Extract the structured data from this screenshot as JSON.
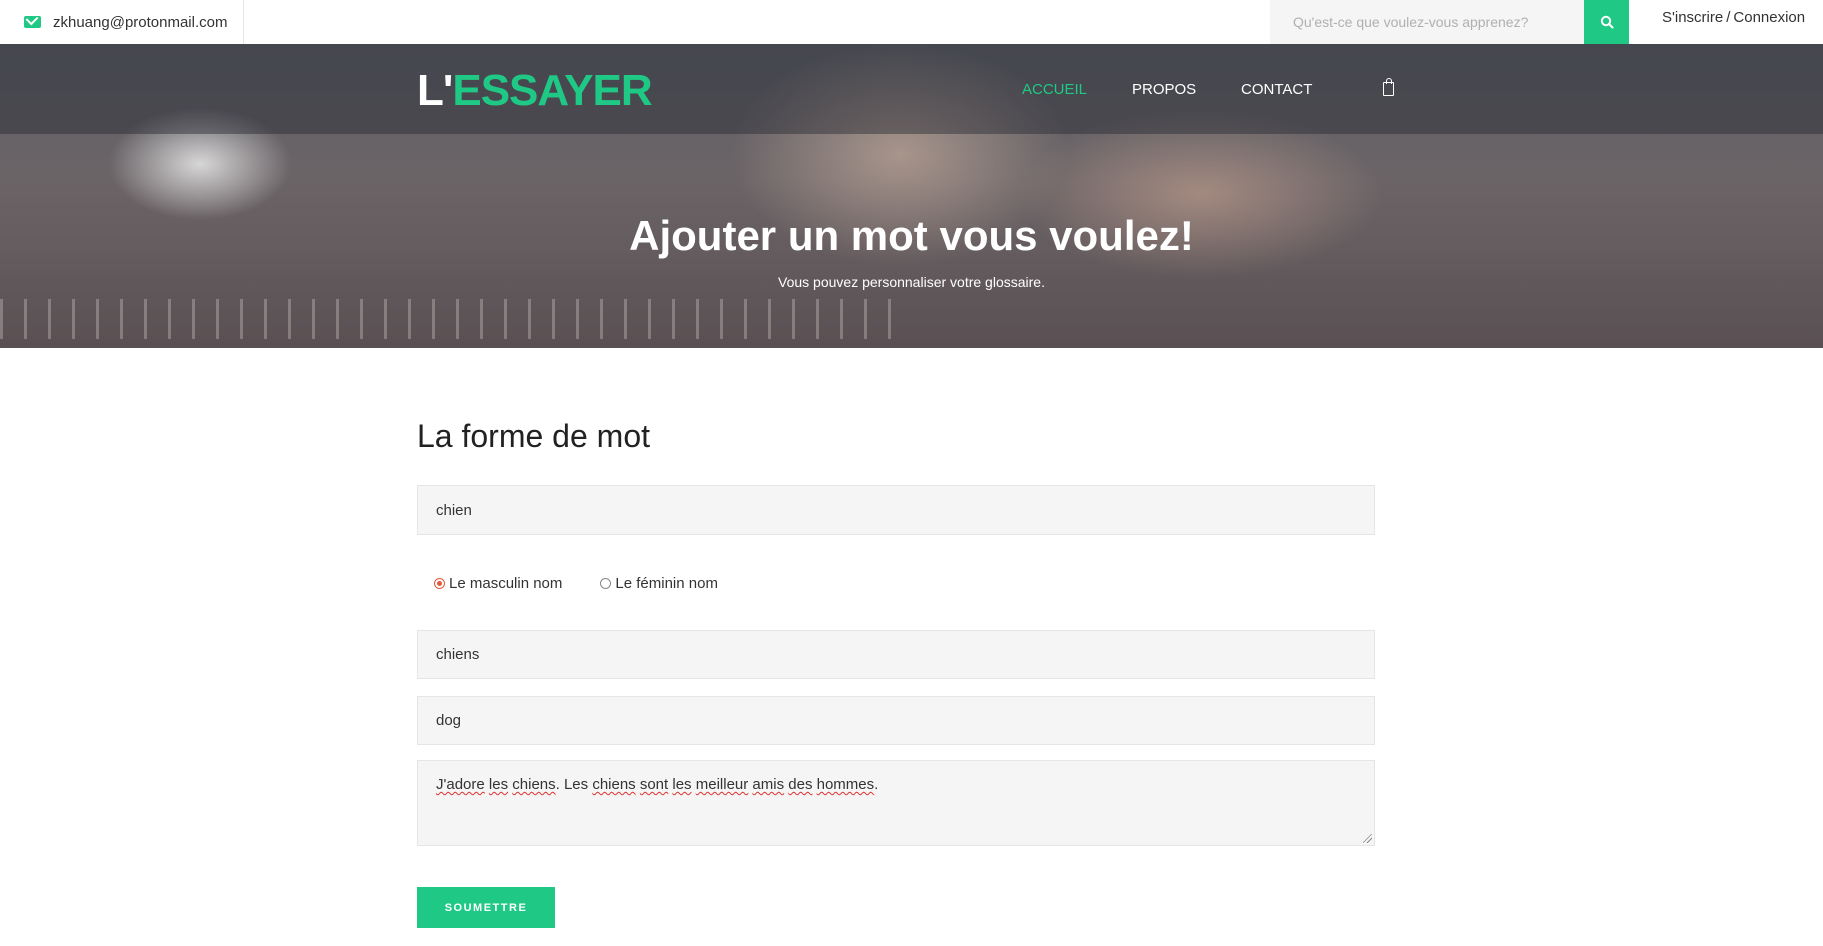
{
  "topbar": {
    "email": "zkhuang@protonmail.com",
    "search_placeholder": "Qu'est-ce que voulez-vous apprenez?",
    "auth_signup": "S'inscrire",
    "auth_separator": "/",
    "auth_login": "Connexion"
  },
  "header": {
    "logo_part1": "L'",
    "logo_part2": "ESSAYER",
    "nav": [
      "ACCUEIL",
      "PROPOS",
      "CONTACT"
    ],
    "active_nav": "ACCUEIL"
  },
  "hero": {
    "title": "Ajouter un mot vous voulez!",
    "subtitle": "Vous pouvez personnaliser votre glossaire."
  },
  "form": {
    "title": "La forme de mot",
    "word_value": "chien",
    "gender_options": [
      "Le masculin nom",
      "Le féminin nom"
    ],
    "gender_selected": "Le masculin nom",
    "plural_value": "chiens",
    "translation_value": "dog",
    "example_words": [
      "J'adore",
      " ",
      "les",
      " ",
      "chiens",
      ". Les ",
      "chiens",
      " ",
      "sont",
      " ",
      "les",
      " ",
      "meilleur",
      " ",
      "amis",
      " ",
      "des",
      " ",
      "hommes",
      "."
    ],
    "submit_label": "SOUMETTRE"
  },
  "colors": {
    "accent": "#1fc985",
    "radio_checked": "#e05a3a",
    "field_bg": "#f5f5f5"
  }
}
